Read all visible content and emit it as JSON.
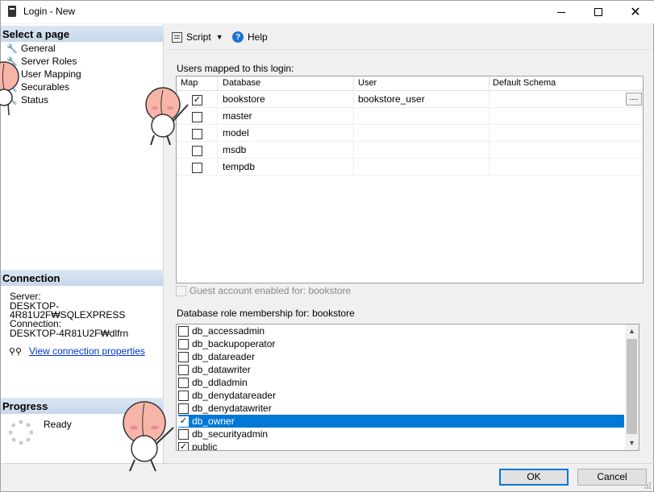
{
  "window": {
    "title": "Login - New"
  },
  "left": {
    "select_page_label": "Select a page",
    "nav": [
      {
        "label": "General",
        "icon": "wrench-icon"
      },
      {
        "label": "Server Roles",
        "icon": "wrench-icon"
      },
      {
        "label": "User Mapping",
        "icon": "wrench-icon"
      },
      {
        "label": "Securables",
        "icon": "wrench-icon"
      },
      {
        "label": "Status",
        "icon": "wrench-icon"
      }
    ],
    "connection_label": "Connection",
    "server_label": "Server:",
    "server_value": "DESKTOP-4R81U2F₩SQLEXPRESS",
    "connection_sub_label": "Connection:",
    "connection_value": "DESKTOP-4R81U2F₩dlfrn",
    "view_connection_link": "View connection properties",
    "progress_label": "Progress",
    "progress_status": "Ready"
  },
  "toolbar": {
    "script_label": "Script",
    "help_label": "Help"
  },
  "mapping": {
    "title": "Users mapped to this login:",
    "columns": [
      "Map",
      "Database",
      "User",
      "Default Schema"
    ],
    "rows": [
      {
        "checked": true,
        "database": "bookstore",
        "user": "bookstore_user",
        "schema": ""
      },
      {
        "checked": false,
        "database": "master",
        "user": "",
        "schema": ""
      },
      {
        "checked": false,
        "database": "model",
        "user": "",
        "schema": ""
      },
      {
        "checked": false,
        "database": "msdb",
        "user": "",
        "schema": ""
      },
      {
        "checked": false,
        "database": "tempdb",
        "user": "",
        "schema": ""
      }
    ],
    "ellipsis_label": "...."
  },
  "guest": {
    "label": "Guest account enabled for: bookstore",
    "checked": false
  },
  "roles": {
    "title": "Database role membership for: bookstore",
    "items": [
      {
        "name": "db_accessadmin",
        "checked": false,
        "selected": false
      },
      {
        "name": "db_backupoperator",
        "checked": false,
        "selected": false
      },
      {
        "name": "db_datareader",
        "checked": false,
        "selected": false
      },
      {
        "name": "db_datawriter",
        "checked": false,
        "selected": false
      },
      {
        "name": "db_ddladmin",
        "checked": false,
        "selected": false
      },
      {
        "name": "db_denydatareader",
        "checked": false,
        "selected": false
      },
      {
        "name": "db_denydatawriter",
        "checked": false,
        "selected": false
      },
      {
        "name": "db_owner",
        "checked": true,
        "selected": true
      },
      {
        "name": "db_securityadmin",
        "checked": false,
        "selected": false
      },
      {
        "name": "public",
        "checked": true,
        "selected": false
      }
    ]
  },
  "buttons": {
    "ok": "OK",
    "cancel": "Cancel"
  },
  "colors": {
    "selection": "#0078d7",
    "link": "#0033cc",
    "section_header": "#c7d7ea",
    "mascot_peach": "#f7b5a8"
  }
}
